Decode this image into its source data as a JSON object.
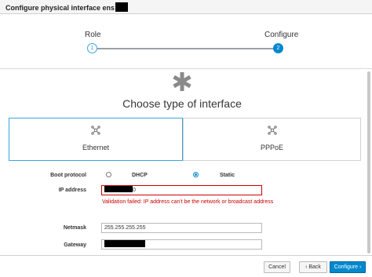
{
  "dialog": {
    "title": "Configure physical interface ens"
  },
  "wizard": {
    "steps": [
      {
        "label": "Role",
        "number": "1"
      },
      {
        "label": "Configure",
        "number": "2"
      }
    ]
  },
  "main": {
    "heading": "Choose type of interface",
    "types": [
      {
        "label": "Ethernet",
        "selected": true
      },
      {
        "label": "PPPoE",
        "selected": false
      }
    ],
    "form": {
      "boot_protocol_label": "Boot protocol",
      "boot_options": [
        {
          "label": "DHCP",
          "checked": false
        },
        {
          "label": "Static",
          "checked": true
        }
      ],
      "ip_label": "IP address",
      "ip_value_suffix": "0",
      "ip_error": "Validation failed: IP address can't be the network or broadcast address",
      "netmask_label": "Netmask",
      "netmask_value": "255.255.255.255",
      "gateway_label": "Gateway"
    }
  },
  "footer": {
    "cancel_label": "Cancel",
    "back_label": "‹ Back",
    "configure_label": "Configure ›"
  },
  "colors": {
    "primary": "#0088ce",
    "selected_border": "#39a5dc",
    "error": "#cc0000"
  },
  "icons": [
    "asterisk-icon",
    "network-icon",
    "chevron-left-icon",
    "chevron-right-icon"
  ]
}
